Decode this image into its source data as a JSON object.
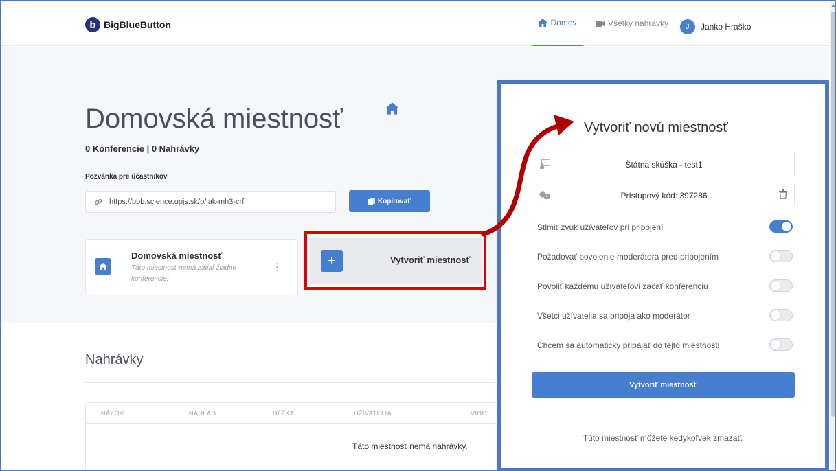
{
  "nav": {
    "logo_letter": "b",
    "logo_text": "BigBlueButton",
    "home_label": "Domov",
    "recordings_label": "Všetky nahrávky",
    "user_initial": "J",
    "user_name": "Janko Hraško"
  },
  "room": {
    "title": "Domovská miestnosť",
    "stats": "0 Konferencie | 0 Nahrávky",
    "invite_label": "Pozvánka pre účastníkov",
    "invite_url": "https://bbb.science.upjs.sk/b/jak-mh3-crf",
    "copy_label": "Kopírovať"
  },
  "room_card": {
    "title": "Domovská miestnosť",
    "subtitle": "Táto miestnosť nemá zatiaľ žiadne konferencie!"
  },
  "create_card": {
    "plus": "+",
    "label": "Vytvoriť miestnosť"
  },
  "recordings": {
    "title": "Nahrávky",
    "columns": [
      "NÁZOV",
      "NÁHĽAD",
      "DĹŽKA",
      "UŽÍVATELIA",
      "VIDIT"
    ],
    "empty": "Táto miestnosť nemá nahrávky."
  },
  "modal": {
    "title": "Vytvoriť novú miestnosť",
    "room_name_value": "Štátna skúška - test1",
    "access_code_value": "Prístupový kód: 397286",
    "options": [
      {
        "label": "Stlmiť zvuk užívateľov pri pripojení",
        "on": true
      },
      {
        "label": "Požadovať povolenie moderátora pred pripojením",
        "on": false
      },
      {
        "label": "Povoliť každému užívateľovi začať konferenciu",
        "on": false
      },
      {
        "label": "Všetci užívatelia sa pripoja ako moderátor",
        "on": false
      },
      {
        "label": "Chcem sa automaticky pripájať do tejto miestnosti",
        "on": false
      }
    ],
    "submit_label": "Vytvoriť miestnosť",
    "footer": "Túto miestnosť môžete kedykoľvek zmazať."
  },
  "colors": {
    "accent": "#467fcf",
    "highlight_red": "#e00000",
    "annotation_frame": "#4a78c4"
  }
}
